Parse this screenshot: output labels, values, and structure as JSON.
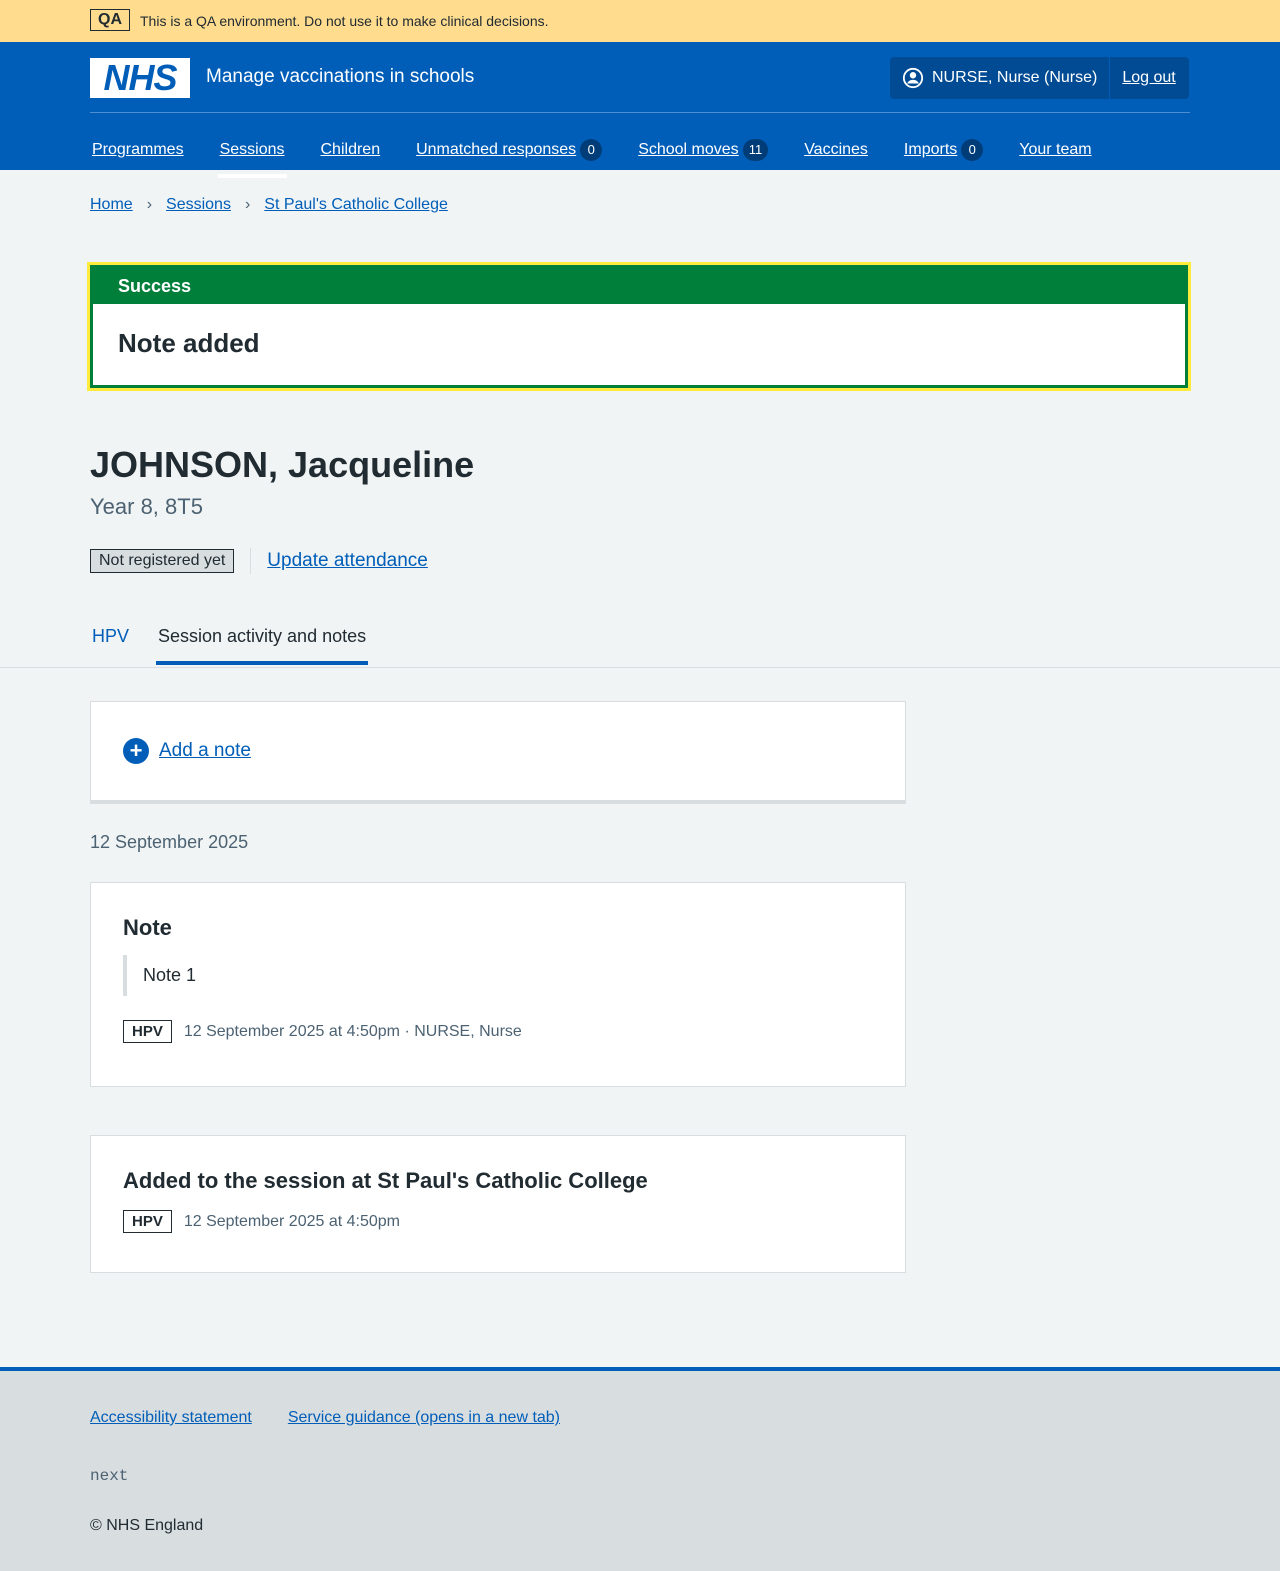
{
  "qa": {
    "tag": "QA",
    "message": "This is a QA environment. Do not use it to make clinical decisions."
  },
  "header": {
    "logo": "NHS",
    "service": "Manage vaccinations in schools",
    "user": "NURSE, Nurse (Nurse)",
    "logout": "Log out"
  },
  "nav": [
    {
      "label": "Programmes"
    },
    {
      "label": "Sessions",
      "active": true
    },
    {
      "label": "Children"
    },
    {
      "label": "Unmatched responses",
      "count": "0"
    },
    {
      "label": "School moves",
      "count": "11"
    },
    {
      "label": "Vaccines"
    },
    {
      "label": "Imports",
      "count": "0"
    },
    {
      "label": "Your team"
    }
  ],
  "breadcrumb": [
    "Home",
    "Sessions",
    "St Paul's Catholic College"
  ],
  "success": {
    "title": "Success",
    "message": "Note added"
  },
  "patient": {
    "name": "JOHNSON, Jacqueline",
    "year": "Year 8, 8T5",
    "status": "Not registered yet",
    "update": "Update attendance"
  },
  "tabs": [
    "HPV",
    "Session activity and notes"
  ],
  "add_note": "Add a note",
  "date_heading": "12 September 2025",
  "note": {
    "title": "Note",
    "text": "Note 1",
    "tag": "HPV",
    "meta": "12 September 2025 at 4:50pm · NURSE, Nurse"
  },
  "activity": {
    "title": "Added to the session at St Paul's Catholic College",
    "tag": "HPV",
    "meta": "12 September 2025 at 4:50pm"
  },
  "footer": {
    "links": [
      "Accessibility statement",
      "Service guidance (opens in a new tab)"
    ],
    "version": "next",
    "copyright": "© NHS England"
  }
}
